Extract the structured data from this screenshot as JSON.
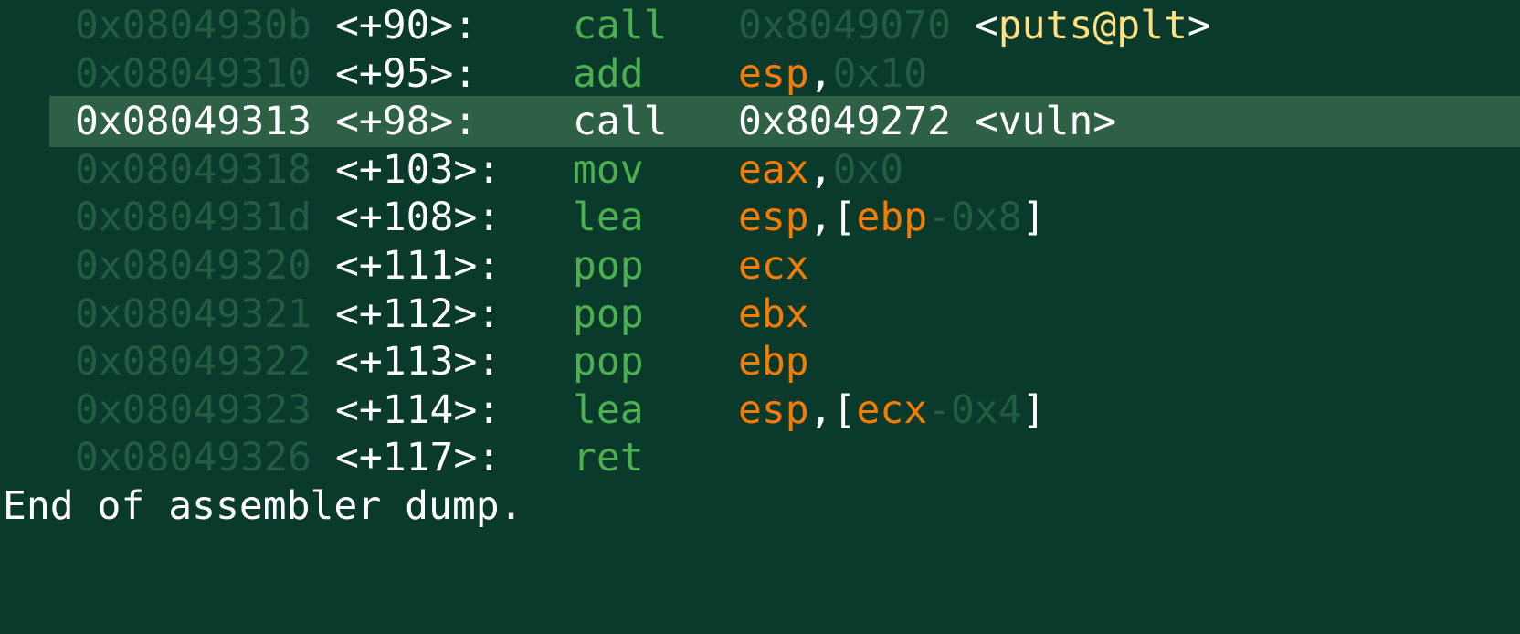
{
  "colors": {
    "background": "#093a2c",
    "highlight_row": "#2d6044",
    "address_dim": "#245c41",
    "mnemonic": "#4caf50",
    "register": "#f57c00",
    "symbol": "#ffe082",
    "text": "#ffffff"
  },
  "instructions": [
    {
      "address": "0x0804930b",
      "offset": "<+90>:",
      "mnemonic": "call",
      "current": false,
      "operands": [
        {
          "t": "0x8049070",
          "k": "imm"
        },
        {
          "t": " <",
          "k": "punct"
        },
        {
          "t": "puts@plt",
          "k": "sym"
        },
        {
          "t": ">",
          "k": "punct"
        }
      ]
    },
    {
      "address": "0x08049310",
      "offset": "<+95>:",
      "mnemonic": "add",
      "current": false,
      "operands": [
        {
          "t": "esp",
          "k": "reg"
        },
        {
          "t": ",",
          "k": "punct"
        },
        {
          "t": "0x10",
          "k": "imm"
        }
      ]
    },
    {
      "address": "0x08049313",
      "offset": "<+98>:",
      "mnemonic": "call",
      "current": true,
      "operands": [
        {
          "t": "0x8049272 <vuln>",
          "k": "punct"
        }
      ]
    },
    {
      "address": "0x08049318",
      "offset": "<+103>:",
      "mnemonic": "mov",
      "current": false,
      "operands": [
        {
          "t": "eax",
          "k": "reg"
        },
        {
          "t": ",",
          "k": "punct"
        },
        {
          "t": "0x0",
          "k": "imm"
        }
      ]
    },
    {
      "address": "0x0804931d",
      "offset": "<+108>:",
      "mnemonic": "lea",
      "current": false,
      "operands": [
        {
          "t": "esp",
          "k": "reg"
        },
        {
          "t": ",[",
          "k": "punct"
        },
        {
          "t": "ebp",
          "k": "reg"
        },
        {
          "t": "-0x8",
          "k": "imm"
        },
        {
          "t": "]",
          "k": "punct"
        }
      ]
    },
    {
      "address": "0x08049320",
      "offset": "<+111>:",
      "mnemonic": "pop",
      "current": false,
      "operands": [
        {
          "t": "ecx",
          "k": "reg"
        }
      ]
    },
    {
      "address": "0x08049321",
      "offset": "<+112>:",
      "mnemonic": "pop",
      "current": false,
      "operands": [
        {
          "t": "ebx",
          "k": "reg"
        }
      ]
    },
    {
      "address": "0x08049322",
      "offset": "<+113>:",
      "mnemonic": "pop",
      "current": false,
      "operands": [
        {
          "t": "ebp",
          "k": "reg"
        }
      ]
    },
    {
      "address": "0x08049323",
      "offset": "<+114>:",
      "mnemonic": "lea",
      "current": false,
      "operands": [
        {
          "t": "esp",
          "k": "reg"
        },
        {
          "t": ",[",
          "k": "punct"
        },
        {
          "t": "ecx",
          "k": "reg"
        },
        {
          "t": "-0x4",
          "k": "imm"
        },
        {
          "t": "]",
          "k": "punct"
        }
      ]
    },
    {
      "address": "0x08049326",
      "offset": "<+117>:",
      "mnemonic": "ret",
      "current": false,
      "operands": []
    }
  ],
  "footer": "End of assembler dump."
}
